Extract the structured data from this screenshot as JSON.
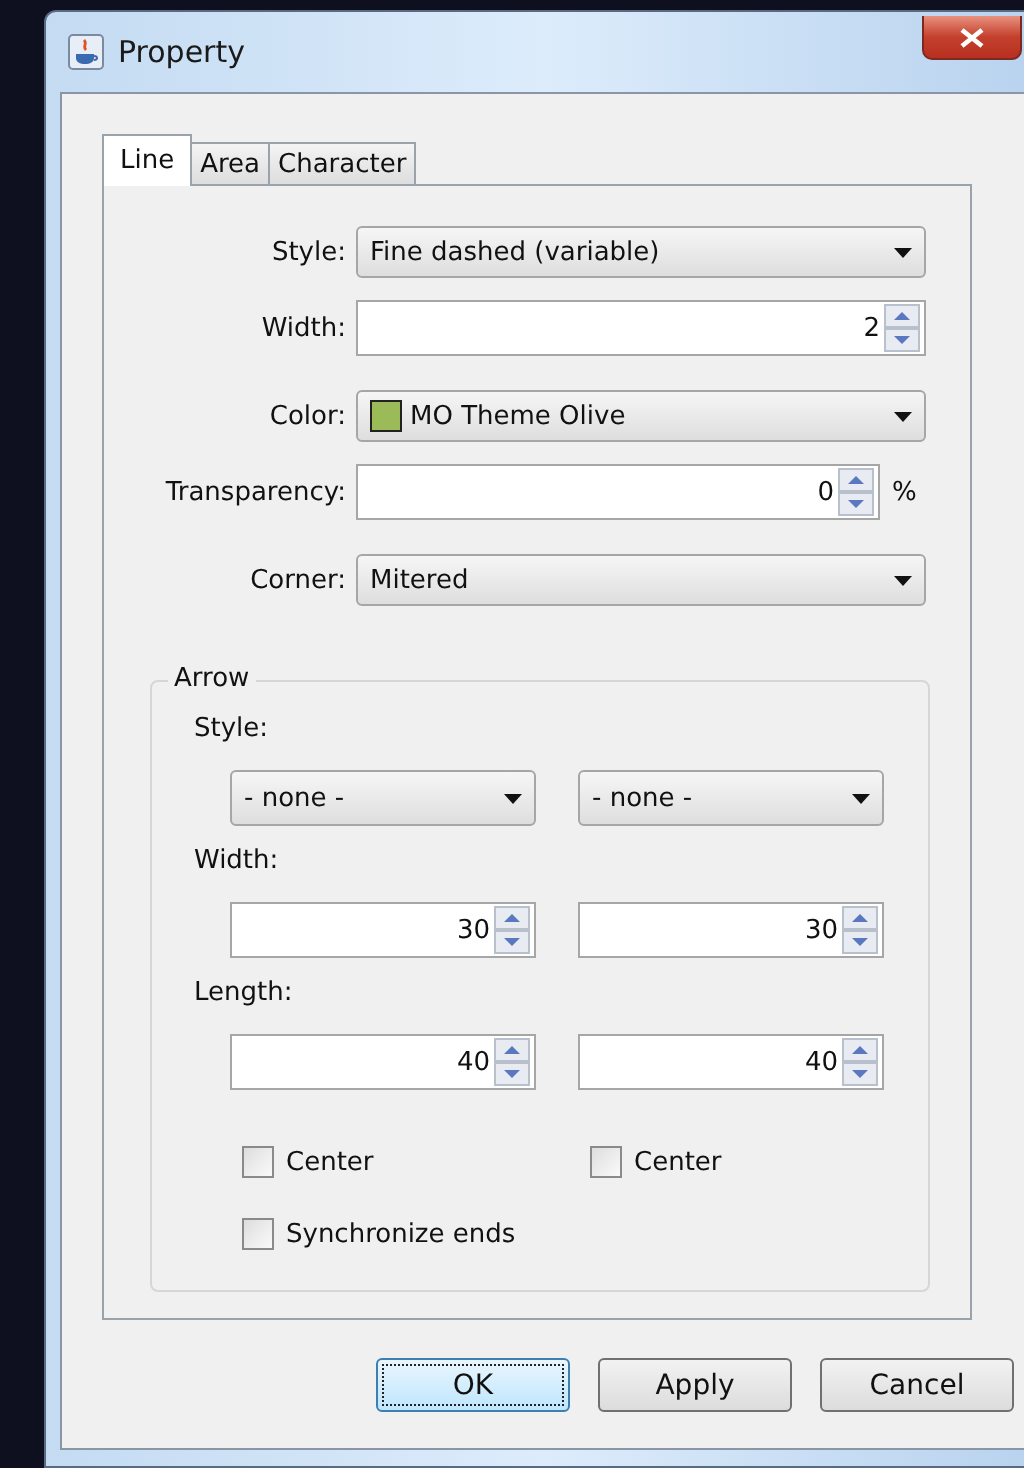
{
  "window": {
    "title": "Property"
  },
  "tabs": [
    {
      "label": "Line",
      "selected": true
    },
    {
      "label": "Area",
      "selected": false
    },
    {
      "label": "Character",
      "selected": false
    }
  ],
  "line": {
    "fields": [
      {
        "kind": "dropdown",
        "label": "Style:",
        "value": "Fine dashed (variable)"
      },
      {
        "kind": "spinner",
        "label": "Width:",
        "value": "2"
      },
      {
        "kind": "color",
        "label": "Color:",
        "value": "MO Theme Olive",
        "color": "#9bbb59"
      },
      {
        "kind": "spinner",
        "label": "Transparency:",
        "value": "0",
        "unit": "%"
      },
      {
        "kind": "dropdown",
        "label": "Corner:",
        "value": "Mitered"
      }
    ]
  },
  "arrow": {
    "title": "Arrow",
    "style_label": "Style:",
    "styles": [
      "- none -",
      "- none -"
    ],
    "width_label": "Width:",
    "widths": [
      "30",
      "30"
    ],
    "length_label": "Length:",
    "lengths": [
      "40",
      "40"
    ],
    "center": [
      {
        "label": "Center",
        "checked": false
      },
      {
        "label": "Center",
        "checked": false
      }
    ],
    "synchronize": {
      "label": "Synchronize ends",
      "checked": false
    }
  },
  "buttons": [
    {
      "label": "OK",
      "focused": true
    },
    {
      "label": "Apply",
      "focused": false
    },
    {
      "label": "Cancel",
      "focused": false
    }
  ]
}
